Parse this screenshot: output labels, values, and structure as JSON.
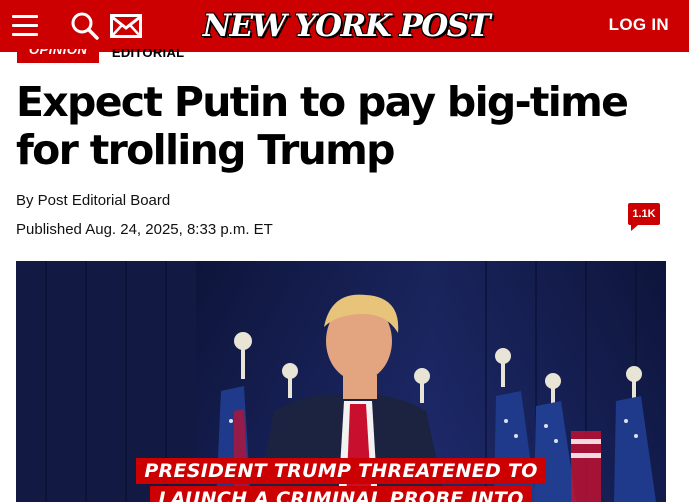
{
  "header": {
    "logo_text": "NEW YORK POST",
    "login_label": "LOG IN",
    "icons": [
      "menu-icon",
      "search-icon",
      "mail-icon"
    ],
    "brand_color": "#cc0000"
  },
  "article": {
    "section_tag": "OPINION",
    "subsection_tag": "EDITORIAL",
    "headline": "Expect Putin to pay big-time for trolling Trump",
    "byline": "By Post Editorial Board",
    "published": "Published Aug. 24, 2025, 8:33 p.m. ET",
    "comment_count": "1.1K"
  },
  "hero_image": {
    "caption_line_1": "PRESIDENT TRUMP THREATENED TO",
    "caption_line_2": "LAUNCH A CRIMINAL PROBE INTO"
  }
}
